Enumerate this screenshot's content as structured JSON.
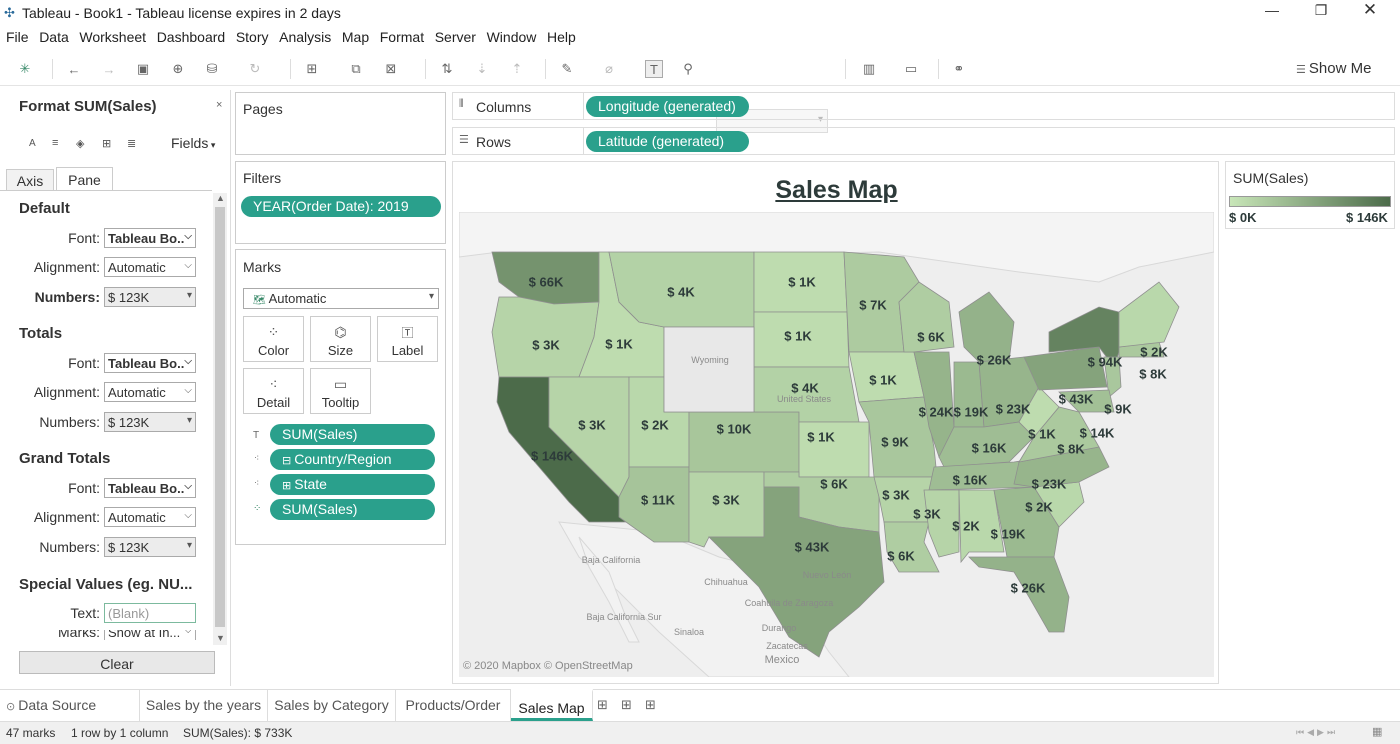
{
  "window": {
    "title": "Tableau - Book1 - Tableau license expires in 2 days"
  },
  "menu": [
    "File",
    "Data",
    "Worksheet",
    "Dashboard",
    "Story",
    "Analysis",
    "Map",
    "Format",
    "Server",
    "Window",
    "Help"
  ],
  "toolbar": {
    "show_me": "Show Me"
  },
  "format_pane": {
    "title": "Format SUM(Sales)",
    "fields_label": "Fields",
    "tabs": [
      "Axis",
      "Pane"
    ],
    "active_tab": "Pane",
    "sections": [
      {
        "heading": "Default",
        "font": "Tableau Bo..",
        "alignment": "Automatic",
        "numbers": "$ 123K",
        "numbers_label": "Numbers:"
      },
      {
        "heading": "Totals",
        "font": "Tableau Bo..",
        "alignment": "Automatic",
        "numbers": "$ 123K",
        "numbers_label": "Numbers:"
      },
      {
        "heading": "Grand Totals",
        "font": "Tableau Bo..",
        "alignment": "Automatic",
        "numbers": "$ 123K",
        "numbers_label": "Numbers:"
      }
    ],
    "font_label": "Font:",
    "alignment_label": "Alignment:",
    "special_heading": "Special Values (eg. NU...",
    "text_label": "Text:",
    "text_value": "(Blank)",
    "marks_label": "Marks:",
    "marks_value": "Show at In...",
    "clear_button": "Clear"
  },
  "pages_card": {
    "title": "Pages"
  },
  "filters_card": {
    "title": "Filters",
    "filter": "YEAR(Order Date): 2019"
  },
  "marks_card": {
    "title": "Marks",
    "type": "Automatic",
    "buttons": [
      "Color",
      "Size",
      "Label",
      "Detail",
      "Tooltip"
    ],
    "fields": [
      "SUM(Sales)",
      "Country/Region",
      "State",
      "SUM(Sales)"
    ]
  },
  "shelves": {
    "columns_label": "Columns",
    "columns_pill": "Longitude (generated)",
    "rows_label": "Rows",
    "rows_pill": "Latitude (generated)"
  },
  "view": {
    "title": "Sales Map",
    "attribution": "© 2020 Mapbox © OpenStreetMap",
    "base_labels": [
      "Wyoming",
      "Baja California",
      "Chihuahua",
      "Coahuila de Zaragoza",
      "Baja California Sur",
      "Durango",
      "Nuevo León",
      "Sinaloa",
      "Zacatecas",
      "Mexico",
      "United States"
    ]
  },
  "legend": {
    "title": "SUM(Sales)",
    "min": "$ 0K",
    "max": "$ 146K",
    "color_low": "#c8e6b8",
    "color_high": "#4c6b4a"
  },
  "chart_data": {
    "type": "map",
    "measure": "SUM(Sales)",
    "units": "$K",
    "regions": [
      {
        "name": "Washington",
        "value": 66,
        "label": "$ 66K"
      },
      {
        "name": "Oregon",
        "value": 3,
        "label": "$ 3K"
      },
      {
        "name": "California",
        "value": 146,
        "label": "$ 146K"
      },
      {
        "name": "Idaho",
        "value": 1,
        "label": "$ 1K"
      },
      {
        "name": "Nevada",
        "value": 3,
        "label": "$ 3K"
      },
      {
        "name": "Montana",
        "value": 4,
        "label": "$ 4K"
      },
      {
        "name": "Utah",
        "value": 2,
        "label": "$ 2K"
      },
      {
        "name": "Arizona",
        "value": 11,
        "label": "$ 11K"
      },
      {
        "name": "Colorado",
        "value": 10,
        "label": "$ 10K"
      },
      {
        "name": "New Mexico",
        "value": 3,
        "label": "$ 3K"
      },
      {
        "name": "North Dakota",
        "value": 1,
        "label": "$ 1K"
      },
      {
        "name": "South Dakota",
        "value": 1,
        "label": "$ 1K"
      },
      {
        "name": "Nebraska",
        "value": 4,
        "label": "$ 4K"
      },
      {
        "name": "Kansas",
        "value": 1,
        "label": "$ 1K"
      },
      {
        "name": "Oklahoma",
        "value": 6,
        "label": "$ 6K"
      },
      {
        "name": "Texas",
        "value": 43,
        "label": "$ 43K"
      },
      {
        "name": "Minnesota",
        "value": 7,
        "label": "$ 7K"
      },
      {
        "name": "Iowa",
        "value": 1,
        "label": "$ 1K"
      },
      {
        "name": "Missouri",
        "value": 9,
        "label": "$ 9K"
      },
      {
        "name": "Arkansas",
        "value": 3,
        "label": "$ 3K"
      },
      {
        "name": "Louisiana",
        "value": 6,
        "label": "$ 6K"
      },
      {
        "name": "Wisconsin",
        "value": 6,
        "label": "$ 6K"
      },
      {
        "name": "Illinois",
        "value": 24,
        "label": "$ 24K"
      },
      {
        "name": "Michigan",
        "value": 26,
        "label": "$ 26K"
      },
      {
        "name": "Indiana",
        "value": 19,
        "label": "$ 19K"
      },
      {
        "name": "Ohio",
        "value": 23,
        "label": "$ 23K"
      },
      {
        "name": "Kentucky",
        "value": 16,
        "label": "$ 16K"
      },
      {
        "name": "Tennessee",
        "value": 16,
        "label": "$ 16K"
      },
      {
        "name": "Mississippi",
        "value": 3,
        "label": "$ 3K"
      },
      {
        "name": "Alabama",
        "value": 2,
        "label": "$ 2K"
      },
      {
        "name": "Georgia",
        "value": 19,
        "label": "$ 19K"
      },
      {
        "name": "Florida",
        "value": 26,
        "label": "$ 26K"
      },
      {
        "name": "South Carolina",
        "value": 2,
        "label": "$ 2K"
      },
      {
        "name": "North Carolina",
        "value": 23,
        "label": "$ 23K"
      },
      {
        "name": "Virginia",
        "value": 8,
        "label": "$ 8K"
      },
      {
        "name": "West Virginia",
        "value": 1,
        "label": "$ 1K"
      },
      {
        "name": "Pennsylvania",
        "value": 43,
        "label": "$ 43K"
      },
      {
        "name": "New York",
        "value": 94,
        "label": "$ 94K"
      },
      {
        "name": "New Jersey",
        "value": 9,
        "label": "$ 9K"
      },
      {
        "name": "Maryland",
        "value": 14,
        "label": "$ 14K"
      },
      {
        "name": "Massachusetts",
        "value": 8,
        "label": "$ 8K"
      },
      {
        "name": "Maine / New England",
        "value": 2,
        "label": "$ 2K"
      },
      {
        "name": "Wyoming",
        "value": null,
        "label": ""
      }
    ]
  },
  "sheet_tabs": {
    "data_source": "Data Source",
    "tabs": [
      "Sales by the years",
      "Sales by Category",
      "Products/Order",
      "Sales Map"
    ],
    "active": "Sales Map"
  },
  "status": {
    "marks": "47 marks",
    "dims": "1 row by 1 column",
    "sum": "SUM(Sales): $ 733K"
  }
}
